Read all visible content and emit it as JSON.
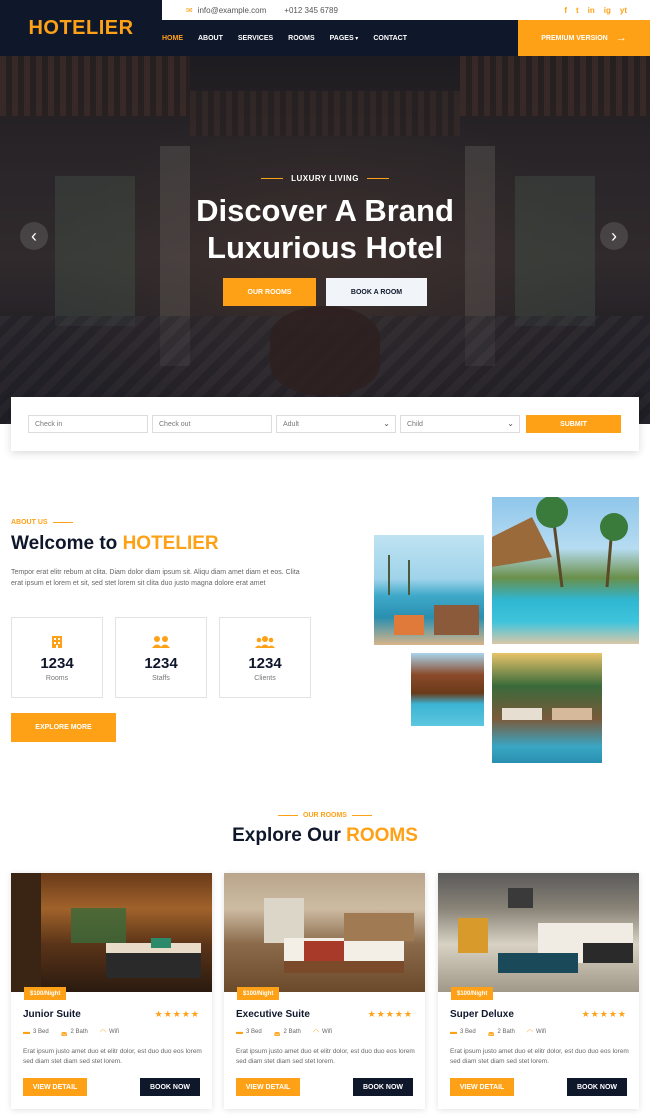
{
  "brand": {
    "logo": "HOTELIER"
  },
  "topbar": {
    "email": "info@example.com",
    "phone": "+012 345 6789",
    "socials": [
      "f",
      "t",
      "in",
      "ig",
      "yt"
    ]
  },
  "nav": {
    "items": [
      "HOME",
      "ABOUT",
      "SERVICES",
      "ROOMS",
      "PAGES",
      "CONTACT"
    ],
    "active": "HOME",
    "premium_label": "PREMIUM VERSION"
  },
  "hero": {
    "kicker": "LUXURY LIVING",
    "title_line1": "Discover A Brand",
    "title_line2": "Luxurious Hotel",
    "btn_rooms": "OUR ROOMS",
    "btn_book": "BOOK A ROOM"
  },
  "booking": {
    "checkin_placeholder": "Check in",
    "checkout_placeholder": "Check out",
    "adult": "Adult",
    "child": "Child",
    "submit": "SUBMIT"
  },
  "about": {
    "eyebrow": "ABOUT US",
    "title_prefix": "Welcome to",
    "title_highlight": "HOTELIER",
    "text": "Tempor erat elitr rebum at clita. Diam dolor diam ipsum sit. Aliqu diam amet diam et eos. Clita erat ipsum et lorem et sit, sed stet lorem sit clita duo justo magna dolore erat amet",
    "stats": [
      {
        "num": "1234",
        "label": "Rooms",
        "icon": "hotel-icon"
      },
      {
        "num": "1234",
        "label": "Staffs",
        "icon": "users-cog-icon"
      },
      {
        "num": "1234",
        "label": "Clients",
        "icon": "users-icon"
      }
    ],
    "explore": "EXPLORE MORE"
  },
  "rooms": {
    "eyebrow": "OUR ROOMS",
    "title_prefix": "Explore Our",
    "title_highlight": "ROOMS",
    "cards": [
      {
        "name": "Junior Suite",
        "price": "$100/Night",
        "bed": "3 Bed",
        "bath": "2 Bath",
        "wifi": "Wifi",
        "text": "Erat ipsum justo amet duo et elitr dolor, est duo duo eos lorem sed diam stet diam sed stet lorem.",
        "detail": "VIEW DETAIL",
        "book": "BOOK NOW",
        "stars": "★★★★★"
      },
      {
        "name": "Executive Suite",
        "price": "$100/Night",
        "bed": "3 Bed",
        "bath": "2 Bath",
        "wifi": "Wifi",
        "text": "Erat ipsum justo amet duo et elitr dolor, est duo duo eos lorem sed diam stet diam sed stet lorem.",
        "detail": "VIEW DETAIL",
        "book": "BOOK NOW",
        "stars": "★★★★★"
      },
      {
        "name": "Super Deluxe",
        "price": "$100/Night",
        "bed": "3 Bed",
        "bath": "2 Bath",
        "wifi": "Wifi",
        "text": "Erat ipsum justo amet duo et elitr dolor, est duo duo eos lorem sed diam stet diam sed stet lorem.",
        "detail": "VIEW DETAIL",
        "book": "BOOK NOW",
        "stars": "★★★★★"
      }
    ]
  },
  "colors": {
    "accent": "#fea116",
    "dark": "#0f172b"
  }
}
